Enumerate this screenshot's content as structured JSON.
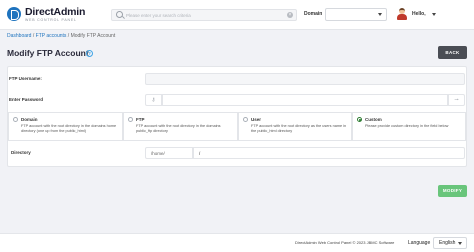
{
  "header": {
    "logo_name": "DirectAdmin",
    "logo_tagline": "WEB CONTROL PANEL",
    "search_placeholder": "Please enter your search criteria",
    "search_clear": "×",
    "domain_label": "Domain",
    "domain_value": "",
    "user_greeting": "Hello,"
  },
  "breadcrumb": {
    "links": [
      "Dashboard",
      "FTP accounts"
    ],
    "separator": " / ",
    "current": "Modify FTP Account"
  },
  "page": {
    "title": "Modify FTP Account",
    "help_icon_glyph": "?",
    "back_label": "BACK",
    "modify_label": "MODIFY"
  },
  "form": {
    "username_label": "FTP Username:",
    "username_value": "",
    "password_label": "Enter Password",
    "password_value": "",
    "generate_glyph": "⚷",
    "toggle_glyph": "⊸",
    "directory_label": "Directory",
    "directory_prefix": "/home/",
    "directory_value": "/",
    "options": [
      {
        "title": "Domain",
        "desc": "FTP account with the root directory in the domains home directory (one up from the public_html)",
        "selected": false
      },
      {
        "title": "FTP",
        "desc": "FTP account with the root directory in the domains public_ftp directory",
        "selected": false
      },
      {
        "title": "User",
        "desc": "FTP account with the root directory as the users name in the public_html directory",
        "selected": false
      },
      {
        "title": "Custom",
        "desc": "Please provide custom directory in the field below",
        "selected": true
      }
    ]
  },
  "footer": {
    "copyright": "DirectAdmin Web Control Panel © 2023 JBMC Software",
    "language_label": "Language",
    "language_value": "English"
  },
  "colors": {
    "accent": "#1e73be",
    "back_button": "#4a4d54",
    "modify_button": "#69c57b",
    "selected_radio": "#2e7d32"
  }
}
